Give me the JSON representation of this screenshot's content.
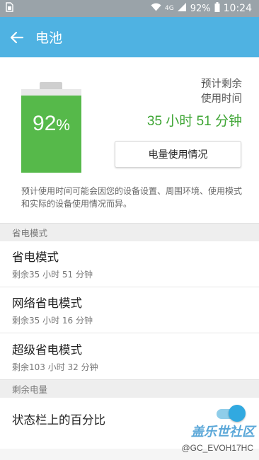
{
  "status_bar": {
    "network": "4G",
    "battery_text": "92%",
    "time": "10:24"
  },
  "app_bar": {
    "title": "电池"
  },
  "battery": {
    "level": 0.92,
    "percent_number": "92",
    "percent_unit": "%",
    "fill_color": "#56b94a",
    "est_line1": "预计剩余",
    "est_line2": "使用时间",
    "est_time": "35 小时 51 分钟",
    "usage_button": "电量使用情况",
    "note": "预计使用时间可能会因您的设备设置、周围环境、使用模式和实际的设备使用情况而异。"
  },
  "sections": {
    "power_saving": "省电模式",
    "remaining": "剩余电量"
  },
  "modes": [
    {
      "title": "省电模式",
      "subtitle": "剩余35 小时 51 分钟"
    },
    {
      "title": "网络省电模式",
      "subtitle": "剩余35 小时 16 分钟"
    },
    {
      "title": "超级省电模式",
      "subtitle": "剩余103 小时 32 分钟"
    }
  ],
  "percent_toggle": {
    "label": "状态栏上的百分比",
    "on": true
  },
  "watermark": {
    "logo": "盖乐世社区",
    "user": "@GC_EVOH17HC"
  },
  "colors": {
    "app_bar": "#4fb2e2",
    "accent_green": "#3ea534",
    "switch_on": "#31a9e0"
  }
}
